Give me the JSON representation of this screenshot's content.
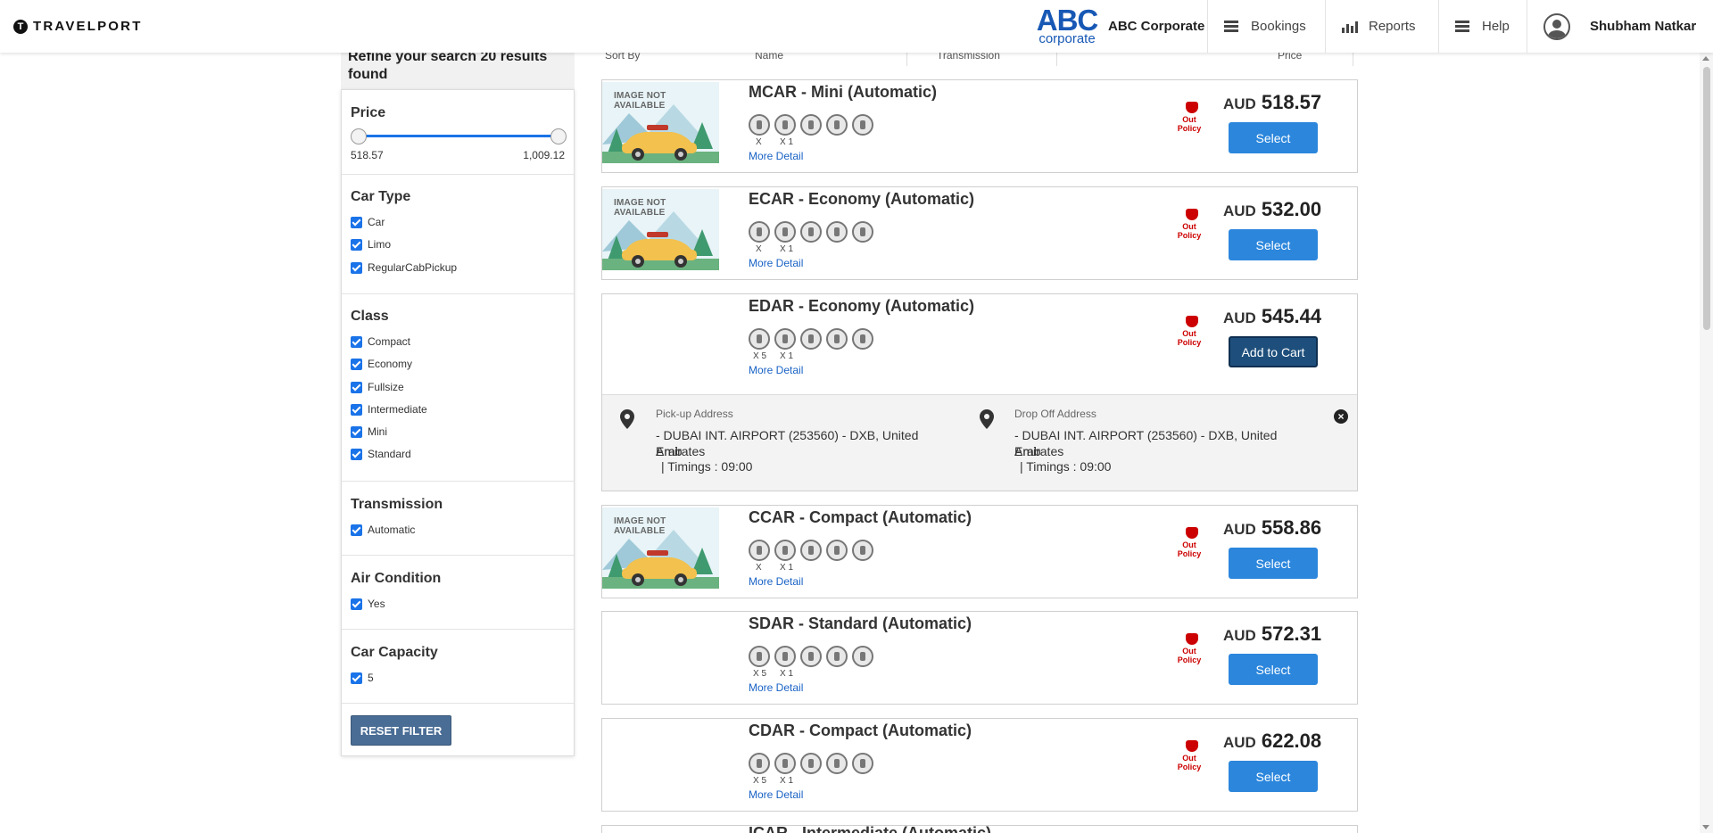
{
  "header": {
    "logo": "TRAVELPORT",
    "brand_abc": "ABC",
    "brand_sub": "corporate",
    "company": "ABC Corporate",
    "nav": {
      "bookings": "Bookings",
      "reports": "Reports",
      "help": "Help"
    },
    "user": "Shubham Natkar"
  },
  "sidebar": {
    "heading": "Refine your search 20 results found",
    "price": {
      "title": "Price",
      "min": "518.57",
      "max": "1,009.12"
    },
    "car_type": {
      "title": "Car Type",
      "options": [
        "Car",
        "Limo",
        "RegularCabPickup"
      ]
    },
    "class": {
      "title": "Class",
      "options": [
        "Compact",
        "Economy",
        "Fullsize",
        "Intermediate",
        "Mini",
        "Standard"
      ]
    },
    "transmission": {
      "title": "Transmission",
      "options": [
        "Automatic"
      ]
    },
    "air_condition": {
      "title": "Air Condition",
      "options": [
        "Yes"
      ]
    },
    "car_capacity": {
      "title": "Car Capacity",
      "options": [
        "5"
      ]
    },
    "reset": "RESET FILTER"
  },
  "sortbar": {
    "sort_by": "Sort By",
    "name": "Name",
    "transmission": "Transmission",
    "price": "Price"
  },
  "cards": [
    {
      "name": "MCAR - Mini (Automatic)",
      "image_text": "IMAGE NOT AVAILABLE",
      "pax": "X",
      "bags": "X 1",
      "more": "More Detail",
      "policy": "Out Policy",
      "currency": "AUD",
      "price": "518.57",
      "button": "Select"
    },
    {
      "name": "ECAR - Economy (Automatic)",
      "image_text": "IMAGE NOT AVAILABLE",
      "pax": "X",
      "bags": "X 1",
      "more": "More Detail",
      "policy": "Out Policy",
      "currency": "AUD",
      "price": "532.00",
      "button": "Select"
    },
    {
      "name": "EDAR - Economy (Automatic)",
      "image_text": "",
      "pax": "X 5",
      "bags": "X 1",
      "more": "More Detail",
      "policy": "Out Policy",
      "currency": "AUD",
      "price": "545.44",
      "button": "Add to Cart"
    },
    {
      "name": "CCAR - Compact (Automatic)",
      "image_text": "IMAGE NOT AVAILABLE",
      "pax": "X",
      "bags": "X 1",
      "more": "More Detail",
      "policy": "Out Policy",
      "currency": "AUD",
      "price": "558.86",
      "button": "Select"
    },
    {
      "name": "SDAR - Standard (Automatic)",
      "image_text": "",
      "pax": "X 5",
      "bags": "X 1",
      "more": "More Detail",
      "policy": "Out Policy",
      "currency": "AUD",
      "price": "572.31",
      "button": "Select"
    },
    {
      "name": "CDAR - Compact (Automatic)",
      "image_text": "",
      "pax": "X 5",
      "bags": "X 1",
      "more": "More Detail",
      "policy": "Out Policy",
      "currency": "AUD",
      "price": "622.08",
      "button": "Select"
    },
    {
      "name": "ICAR - Intermediate (Automatic)"
    }
  ],
  "details": {
    "pickup_label": "Pick-up Address",
    "pickup_line1": "- DUBAI INT. AIRPORT (253560) - DXB, United Arab",
    "pickup_line2": "Emirates",
    "pickup_timing": "| Timings : 09:00",
    "dropoff_label": "Drop Off Address",
    "dropoff_line1": "- DUBAI INT. AIRPORT (253560) - DXB, United Arab",
    "dropoff_line2": "Emirates",
    "dropoff_timing": "| Timings : 09:00"
  },
  "colors": {
    "primary": "#2b86dc",
    "policy": "#cc0000",
    "brand": "#1758b5"
  }
}
